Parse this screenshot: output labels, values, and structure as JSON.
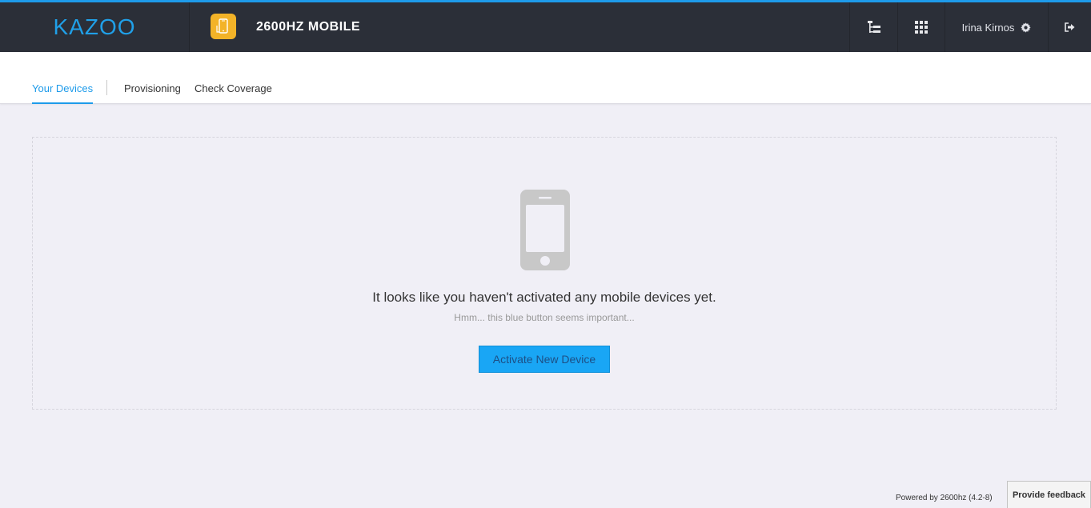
{
  "header": {
    "logo": "KAZOO",
    "app_title": "2600HZ MOBILE",
    "user_name": "Irina Kirnos",
    "icons": {
      "app": "mobile-app-icon",
      "tree": "account-tree-icon",
      "apps": "app-grid-icon",
      "settings": "gear-icon",
      "logout": "logout-icon"
    },
    "colors": {
      "accent": "#1e9bea",
      "bar": "#2b2f38",
      "app_badge": "#f3b328"
    }
  },
  "tabs": [
    {
      "label": "Your Devices",
      "active": true
    },
    {
      "label": "Provisioning",
      "active": false
    },
    {
      "label": "Check Coverage",
      "active": false
    }
  ],
  "empty_state": {
    "icon": "smartphone-icon",
    "title": "It looks like you haven't activated any mobile devices yet.",
    "subtitle": "Hmm... this blue button seems important...",
    "button_label": "Activate New Device"
  },
  "footer": {
    "powered_by": "Powered by 2600hz  (4.2-8)",
    "feedback_label": "Provide feedback"
  }
}
